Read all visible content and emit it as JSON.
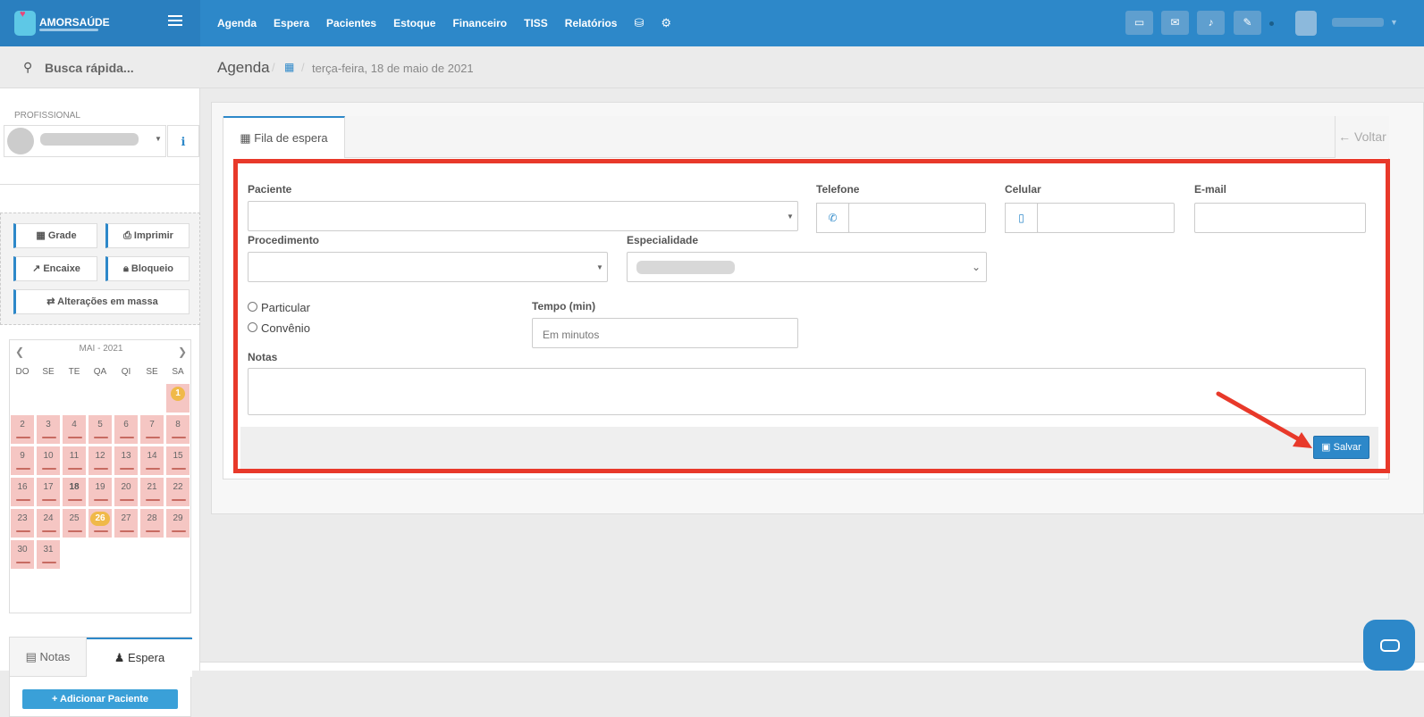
{
  "brand": {
    "name": "AMORSAÚDE"
  },
  "nav": {
    "items": [
      "Agenda",
      "Espera",
      "Pacientes",
      "Estoque",
      "Financeiro",
      "TISS",
      "Relatórios"
    ]
  },
  "sidebar": {
    "quick_search": "Busca rápida...",
    "profissional_label": "PROFISSIONAL",
    "buttons": {
      "grade": "Grade",
      "imprimir": "Imprimir",
      "encaixe": "Encaixe",
      "bloqueio": "Bloqueio",
      "massa": "Alterações em massa"
    },
    "calendar": {
      "month": "MAI - 2021",
      "dow": [
        "DO",
        "SE",
        "TE",
        "QA",
        "QI",
        "SE",
        "SA"
      ],
      "today": "26",
      "selected": "18"
    },
    "tabs": {
      "notas": "Notas",
      "espera": "Espera"
    },
    "add_patient": "Adicionar Paciente"
  },
  "breadcrumb": {
    "title": "Agenda",
    "date": "terça-feira, 18 de maio de 2021"
  },
  "tabs": {
    "fila": "Fila de espera",
    "voltar": "Voltar"
  },
  "form": {
    "paciente": "Paciente",
    "telefone": "Telefone",
    "celular": "Celular",
    "email": "E-mail",
    "procedimento": "Procedimento",
    "especialidade": "Especialidade",
    "particular": "Particular",
    "convenio": "Convênio",
    "tempo": "Tempo (min)",
    "tempo_placeholder": "Em minutos",
    "notas": "Notas",
    "salvar": "Salvar"
  },
  "colors": {
    "primary": "#2d88c9",
    "highlight": "#e8392a",
    "calendar_day": "#f5c6c3",
    "today": "#f0b949"
  }
}
